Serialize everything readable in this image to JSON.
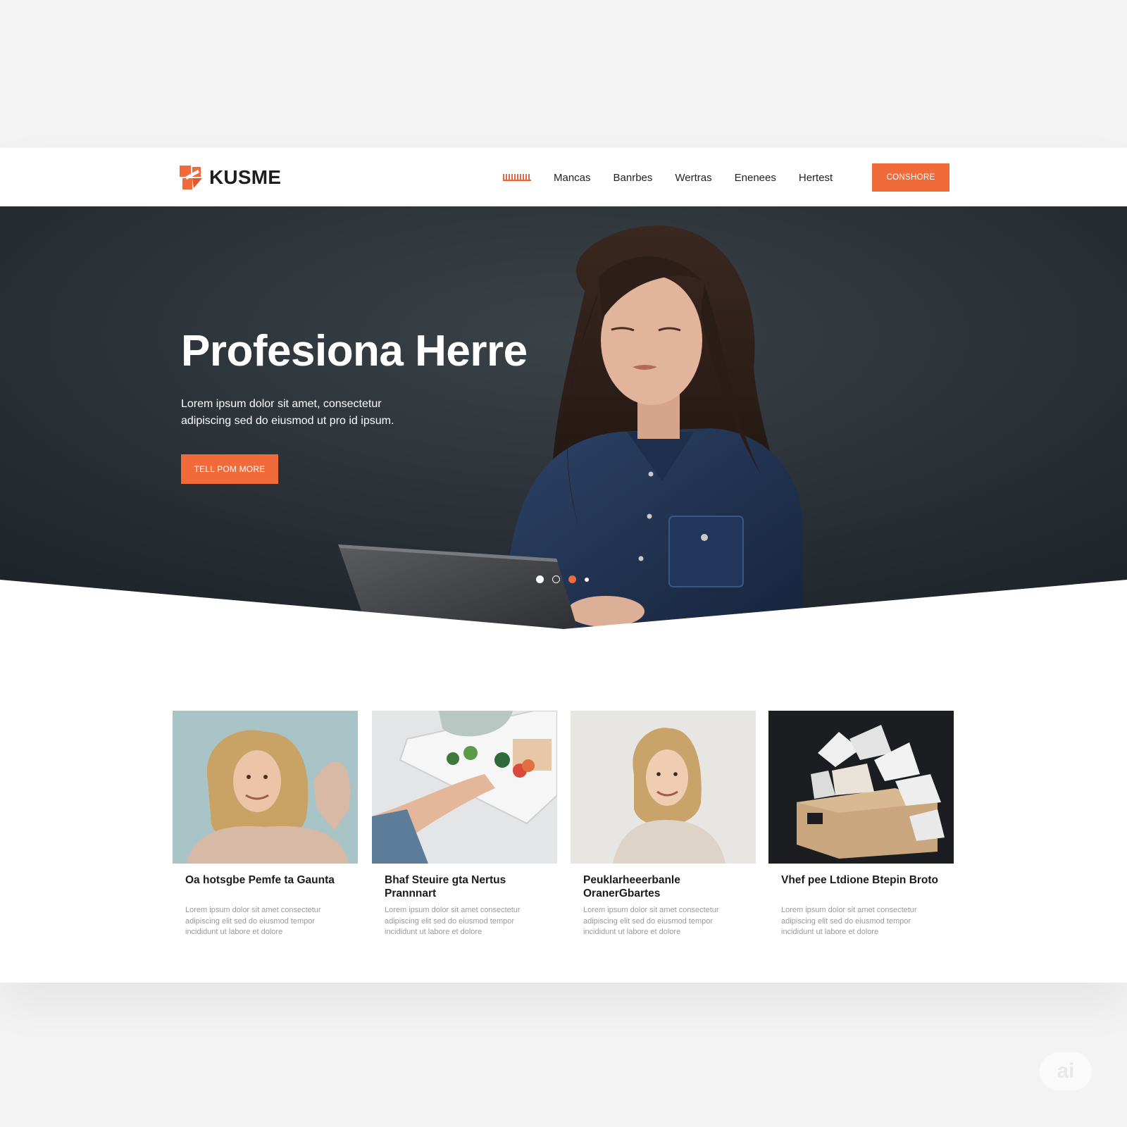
{
  "brand": {
    "name": "KUSME",
    "accent": "#f06a3a"
  },
  "nav": {
    "items": [
      "Mancas",
      "Banrbes",
      "Wertras",
      "Enenees",
      "Hertest"
    ],
    "cta": "CONSHORE"
  },
  "hero": {
    "title": "Profesiona Herre",
    "subtitle": "Lorem ipsum dolor sit amet, consectetur adipiscing sed do eiusmod ut pro id ipsum.",
    "cta": "TELL POM MORE",
    "slides": 4,
    "active_slide": 3
  },
  "cards": [
    {
      "image": "curly-haired-woman-photo",
      "title": "Oa hotsgbe Pemfe ta Gaunta",
      "body": "Lorem ipsum dolor sit amet consectetur adipiscing elit sed do eiusmod tempor incididunt ut labore et dolore"
    },
    {
      "image": "hand-on-tablet-photo",
      "title": "Bhaf Steuire gta Nertus Prannnart",
      "body": "Lorem ipsum dolor sit amet consectetur adipiscing elit sed do eiusmod tempor incididunt ut labore et dolore"
    },
    {
      "image": "smiling-woman-portrait",
      "title": "Peuklarheeerbanle OranerGbartes",
      "body": "Lorem ipsum dolor sit amet consectetur adipiscing elit sed do eiusmod tempor incididunt ut labore et dolore"
    },
    {
      "image": "paper-gift-box-photo",
      "title": "Vhef pee Ltdione Btepin Broto",
      "body": "Lorem ipsum dolor sit amet consectetur adipiscing elit sed do eiusmod tempor incididunt ut labore et dolore"
    }
  ],
  "watermark": "ai"
}
